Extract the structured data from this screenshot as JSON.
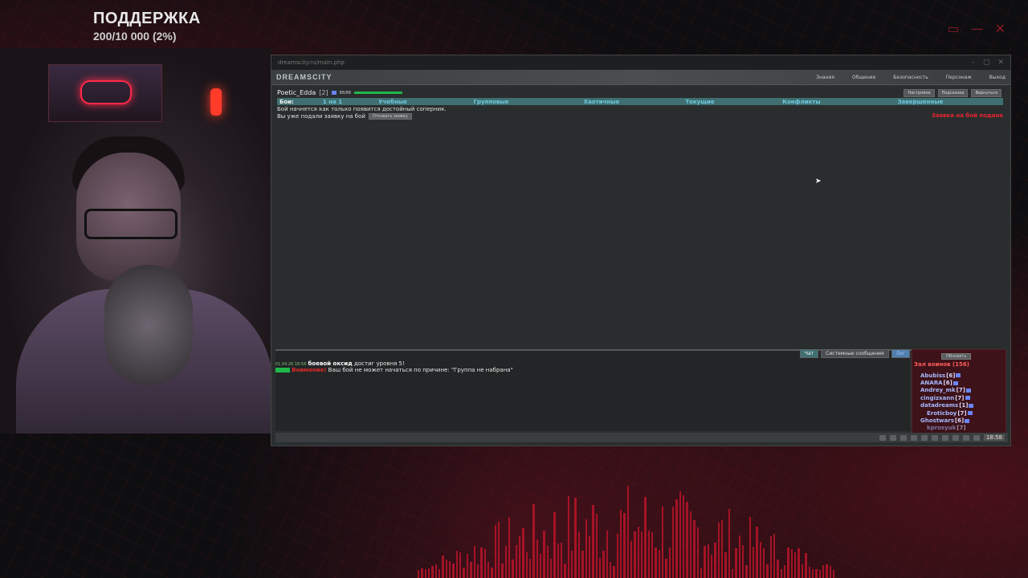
{
  "stream": {
    "support_title": "ПОДДЕРЖКА",
    "support_progress": "200/10 000 (2%)"
  },
  "browser": {
    "url": "dreamscity.ru/main.php",
    "logo": "DREAMSCITY"
  },
  "top_menu": [
    "Знания",
    "Общение",
    "Безопасность",
    "Персонаж",
    "Выход"
  ],
  "character": {
    "name": "Poetic_Edda",
    "level": "[2]",
    "hp": "88/88",
    "hp_fraction": 1.0
  },
  "right_buttons": [
    "Настройки",
    "Подсказка",
    "Вернуться"
  ],
  "fights": {
    "label": "Бои:",
    "tabs": [
      "1 на 1",
      "Учебные",
      "Групповые",
      "Хаотичные",
      "Текущие",
      "Конфликты",
      "Завершенные"
    ],
    "info_line": "Бой начнется как только появится достойный соперник.",
    "applied_line": "Вы уже подали заявку на бой",
    "cancel_button": "Отозвать заявку",
    "apply_link": "Заявка на бой подана"
  },
  "chat": {
    "tabs": [
      "Чат",
      "Системные сообщения",
      "Лог"
    ],
    "messages": [
      {
        "time": "01.04.26 18:56",
        "text_bold": "боевой оксид",
        "text": "достиг уровня 5!"
      },
      {
        "time": "",
        "warning": "Внимание!",
        "text": "Ваш бой не может начаться по причине: \"Группа не набрана\""
      }
    ]
  },
  "players": {
    "refresh": "Обновить",
    "hall": "Зал воинов (156)",
    "list": [
      {
        "name": "Abubiss",
        "level": "[6]"
      },
      {
        "name": "ANARA",
        "level": "[6]"
      },
      {
        "name": "Andrey_mk",
        "level": "[7]"
      },
      {
        "name": "cingizxann",
        "level": "[7]"
      },
      {
        "name": "datadreams",
        "level": "[1]"
      },
      {
        "name": "Eroticboy",
        "level": "[7]"
      },
      {
        "name": "Ghostwars",
        "level": "[6]"
      },
      {
        "name": "kprosyuk",
        "level": "[7]"
      }
    ]
  },
  "clock": "18:58",
  "colors": {
    "accent_teal": "#3f6f70",
    "tab_text": "#6fc7e0",
    "alert_red": "#e82330",
    "hp_green": "#22b548"
  }
}
